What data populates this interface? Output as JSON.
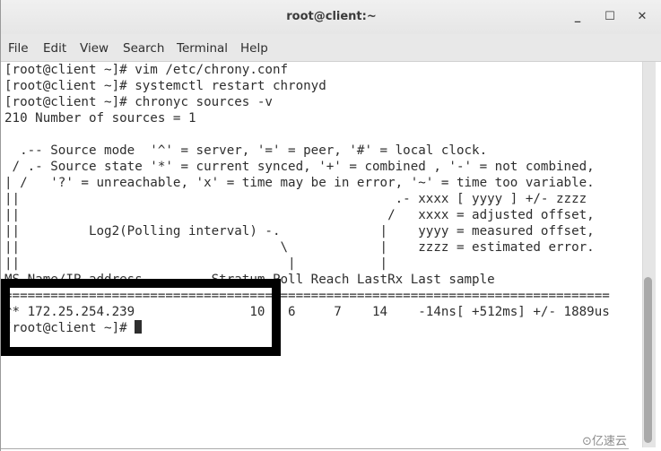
{
  "window": {
    "title": "root@client:~",
    "controls": {
      "minimize": "_",
      "maximize": "☐",
      "close": "✕"
    }
  },
  "menubar": {
    "items": [
      "File",
      "Edit",
      "View",
      "Search",
      "Terminal",
      "Help"
    ]
  },
  "terminal": {
    "lines": [
      "[root@client ~]# vim /etc/chrony.conf",
      "[root@client ~]# systemctl restart chronyd",
      "[root@client ~]# chronyc sources -v",
      "210 Number of sources = 1",
      "",
      "  .-- Source mode  '^' = server, '=' = peer, '#' = local clock.",
      " / .- Source state '*' = current synced, '+' = combined , '-' = not combined,",
      "| /   '?' = unreachable, 'x' = time may be in error, '~' = time too variable.",
      "||                                                 .- xxxx [ yyyy ] +/- zzzz",
      "||                                                /   xxxx = adjusted offset,",
      "||         Log2(Polling interval) -.             |    yyyy = measured offset,",
      "||                                  \\            |    zzzz = estimated error.",
      "||                                   |           |",
      "MS Name/IP address         Stratum Poll Reach LastRx Last sample",
      "===============================================================================",
      "^* 172.25.254.239               10   6     7    14    -14ns[ +512ms] +/- 1889us",
      "[root@client ~]# "
    ],
    "prompt_line_index": 16
  },
  "watermark": "⊙亿速云"
}
